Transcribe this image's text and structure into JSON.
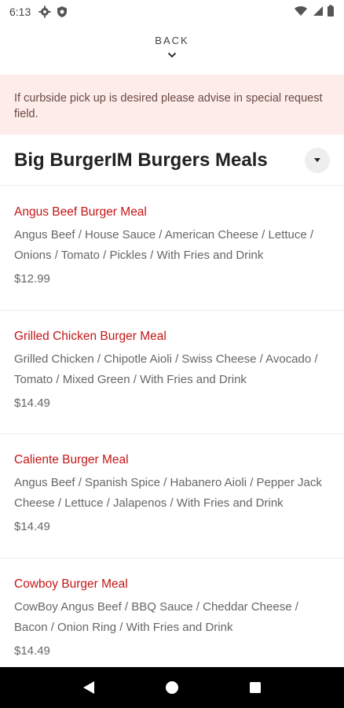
{
  "status_bar": {
    "time": "6:13",
    "icons": [
      "gear-icon",
      "shield-icon",
      "wifi-icon",
      "signal-icon",
      "battery-icon"
    ]
  },
  "back": {
    "label": "BACK",
    "icon": "chevron-down-icon"
  },
  "notice": {
    "text": "If curbside pick up is desired please advise in special request field."
  },
  "category": {
    "title": "Big BurgerIM Burgers Meals",
    "toggle_icon": "caret-down-icon"
  },
  "items": [
    {
      "name": "Angus Beef Burger Meal",
      "description": "Angus Beef / House Sauce / American Cheese / Lettuce / Onions / Tomato / Pickles / With Fries and Drink",
      "price": "$12.99"
    },
    {
      "name": "Grilled Chicken Burger Meal",
      "description": "Grilled Chicken / Chipotle Aioli / Swiss Cheese / Avocado / Tomato / Mixed Green / With Fries and Drink",
      "price": "$14.49"
    },
    {
      "name": "Caliente Burger Meal",
      "description": "Angus Beef / Spanish Spice / Habanero Aioli / Pepper Jack Cheese / Lettuce / Jalapenos / With Fries and Drink",
      "price": "$14.49"
    },
    {
      "name": "Cowboy Burger Meal",
      "description": "CowBoy Angus Beef / BBQ Sauce / Cheddar Cheese / Bacon / Onion Ring / With Fries and Drink",
      "price": "$14.49"
    }
  ],
  "colors": {
    "accent": "#c41616",
    "notice_bg": "#fdece9",
    "nav_bg": "#000000"
  },
  "nav": {
    "icons": [
      "back-triangle-icon",
      "home-circle-icon",
      "recents-square-icon"
    ]
  }
}
